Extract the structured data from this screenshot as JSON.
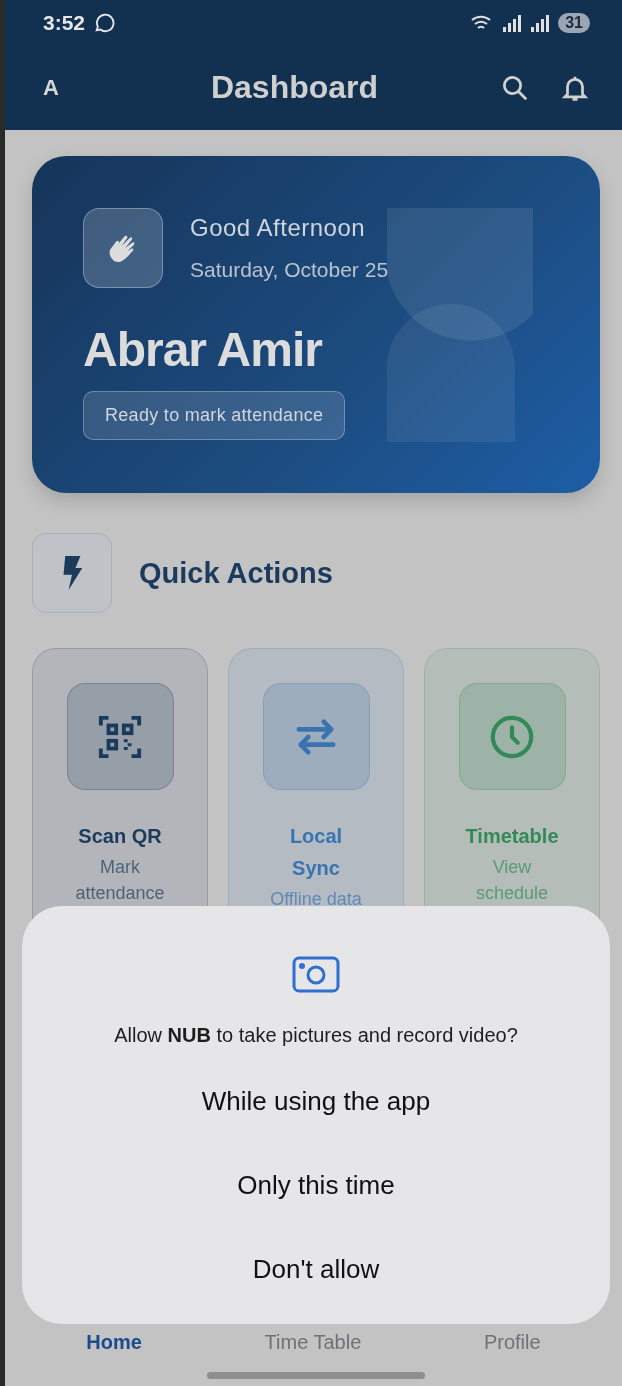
{
  "status_bar": {
    "time": "3:52",
    "battery": "31"
  },
  "app_bar": {
    "avatar": "A",
    "title": "Dashboard"
  },
  "greeting_card": {
    "greeting": "Good Afternoon",
    "date": "Saturday, October 25",
    "name": "Abrar Amir",
    "status": "Ready to mark attendance"
  },
  "quick_actions": {
    "title": "Quick Actions",
    "items": [
      {
        "kind": "scan",
        "title": "Scan QR",
        "subtitle": "Mark attendance",
        "color": "#1b3a5c"
      },
      {
        "kind": "sync",
        "title": "Local Sync",
        "subtitle": "Offline data",
        "color": "#3a74b0"
      },
      {
        "kind": "timetable",
        "title": "Timetable",
        "subtitle": "View schedule",
        "color": "#338a58"
      }
    ]
  },
  "bottom_nav": [
    {
      "label": "Home",
      "selected": true
    },
    {
      "label": "Time Table",
      "selected": false
    },
    {
      "label": "Profile",
      "selected": false
    }
  ],
  "permission_dialog": {
    "message": "Allow **NUB** to take pictures and record video?",
    "options": [
      "While using the app",
      "Only this time",
      "Don't allow"
    ]
  }
}
